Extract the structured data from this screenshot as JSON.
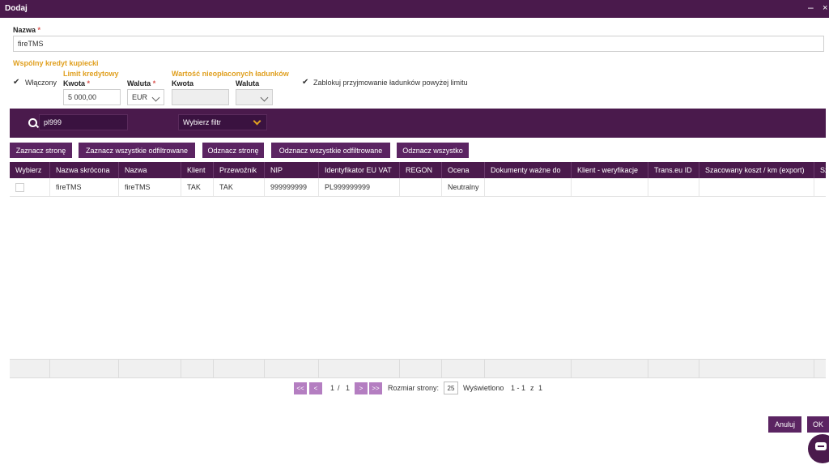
{
  "window": {
    "title": "Dodaj",
    "minimize": "–",
    "close": "×"
  },
  "form": {
    "nazwa_label": "Nazwa",
    "required_mark": "*",
    "nazwa_value": "fireTMS",
    "shared_credit_title": "Wspólny kredyt kupiecki",
    "enabled_label": "Włączony",
    "enabled_checked": true,
    "credit_limit_title": "Limit kredytowy",
    "amount_label": "Kwota",
    "amount_value": "5 000,00",
    "currency_label": "Waluta",
    "currency_value": "EUR",
    "unpaid_title": "Wartość nieopłaconych ładunków",
    "unpaid_amount_label": "Kwota",
    "unpaid_currency_label": "Waluta",
    "block_label": "Zablokuj przyjmowanie ładunków powyżej limitu",
    "block_checked": true
  },
  "filter": {
    "search_value": "pl999",
    "select_placeholder": "Wybierz filtr"
  },
  "actions": [
    "Zaznacz stronę",
    "Zaznacz wszystkie odfiltrowane",
    "Odznacz stronę",
    "Odznacz wszystkie odfiltrowane",
    "Odznacz wszystko"
  ],
  "table": {
    "columns": [
      "Wybierz",
      "Nazwa skrócona",
      "Nazwa",
      "Klient",
      "Przewoźnik",
      "NIP",
      "Identyfikator EU VAT",
      "REGON",
      "Ocena",
      "Dokumenty ważne do",
      "Klient - weryfikacje",
      "Trans.eu ID",
      "Szacowany koszt / km (export)",
      "Sz"
    ],
    "rows": [
      [
        "",
        "fireTMS",
        "fireTMS",
        "TAK",
        "TAK",
        "999999999",
        "PL999999999",
        "",
        "Neutralny",
        "",
        "",
        "",
        "",
        ""
      ]
    ]
  },
  "pagination": {
    "first": "<<",
    "prev": "<",
    "next": ">",
    "last": ">>",
    "page": "1",
    "slash": "/",
    "total_pages": "1",
    "page_size_label": "Rozmiar strony:",
    "page_size": "25",
    "shown_label": "Wyświetlono",
    "range": "1 - 1",
    "of": "z",
    "total": "1"
  },
  "buttons": {
    "cancel": "Anuluj",
    "ok": "OK"
  },
  "colors": {
    "brand": "#4a1a4c",
    "button": "#5b2462",
    "accent": "#e0a020",
    "pager": "#b47ec1"
  }
}
